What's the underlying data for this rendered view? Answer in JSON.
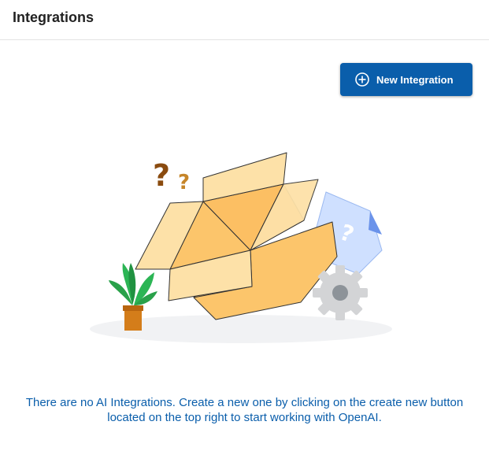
{
  "header": {
    "title": "Integrations"
  },
  "toolbar": {
    "new_button_label": "New Integration",
    "new_button_icon": "plus-circle-icon"
  },
  "empty_state": {
    "line1": "There are no AI Integrations. Create a new one by clicking on the create new button",
    "line2": "located on the top right to start working with OpenAI."
  },
  "colors": {
    "primary": "#0a5eab",
    "title": "#222222",
    "box": "#fbd38a"
  }
}
